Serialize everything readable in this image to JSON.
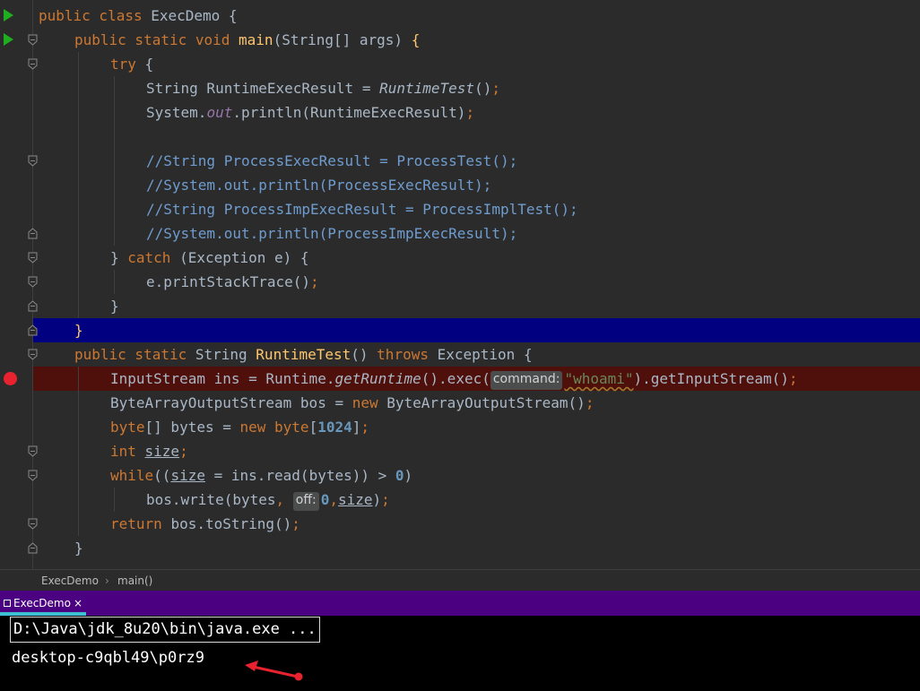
{
  "editor": {
    "lines": [
      [
        [
          "kw",
          "public class "
        ],
        [
          "plain",
          "ExecDemo {"
        ]
      ],
      [
        [
          "kw",
          "public static void "
        ],
        [
          "fn",
          "main"
        ],
        [
          "plain",
          "(String[] args) "
        ],
        [
          "fn",
          "{"
        ]
      ],
      [
        [
          "kw",
          "try "
        ],
        [
          "plain",
          "{"
        ]
      ],
      [
        [
          "plain",
          "String RuntimeExecResult = "
        ],
        [
          "it",
          "RuntimeTest"
        ],
        [
          "plain",
          "()"
        ],
        [
          "kw",
          ";"
        ]
      ],
      [
        [
          "plain",
          "System."
        ],
        [
          "field",
          "out"
        ],
        [
          "plain",
          ".println(RuntimeExecResult)"
        ],
        [
          "kw",
          ";"
        ]
      ],
      [],
      [
        [
          "cm",
          "//String ProcessExecResult = ProcessTest();"
        ]
      ],
      [
        [
          "cm",
          "//System.out.println(ProcessExecResult);"
        ]
      ],
      [
        [
          "cm",
          "//String ProcessImpExecResult = ProcessImplTest();"
        ]
      ],
      [
        [
          "cm",
          "//System.out.println(ProcessImpExecResult);"
        ]
      ],
      [
        [
          "plain",
          "} "
        ],
        [
          "kw",
          "catch "
        ],
        [
          "plain",
          "(Exception e) {"
        ]
      ],
      [
        [
          "plain",
          "e.printStackTrace()"
        ],
        [
          "kw",
          ";"
        ]
      ],
      [
        [
          "plain",
          "}"
        ]
      ],
      [
        [
          "fn",
          "}"
        ]
      ],
      [
        [
          "kw",
          "public static "
        ],
        [
          "plain",
          "String "
        ],
        [
          "fn",
          "RuntimeTest"
        ],
        [
          "plain",
          "() "
        ],
        [
          "kw",
          "throws "
        ],
        [
          "plain",
          "Exception {"
        ]
      ],
      [
        [
          "plain",
          "InputStream ins = Runtime."
        ],
        [
          "it",
          "getRuntime"
        ],
        [
          "plain",
          "().exec("
        ],
        [
          "hint",
          "command:"
        ],
        [
          "strw",
          "\"whoami\""
        ],
        [
          "plain",
          ").getInputStream()"
        ],
        [
          "kw",
          ";"
        ]
      ],
      [
        [
          "plain",
          "ByteArrayOutputStream bos = "
        ],
        [
          "kw",
          "new "
        ],
        [
          "plain",
          "ByteArrayOutputStream()"
        ],
        [
          "kw",
          ";"
        ]
      ],
      [
        [
          "kw",
          "byte"
        ],
        [
          "plain",
          "[] bytes = "
        ],
        [
          "kw",
          "new byte"
        ],
        [
          "plain",
          "["
        ],
        [
          "num",
          "1024"
        ],
        [
          "plain",
          "]"
        ],
        [
          "kw",
          ";"
        ]
      ],
      [
        [
          "kw",
          "int "
        ],
        [
          "u",
          "size"
        ],
        [
          "kw",
          ";"
        ]
      ],
      [
        [
          "kw",
          "while"
        ],
        [
          "plain",
          "(("
        ],
        [
          "u",
          "size"
        ],
        [
          "plain",
          " = ins.read(bytes)) > "
        ],
        [
          "num",
          "0"
        ],
        [
          "plain",
          ")"
        ]
      ],
      [
        [
          "plain",
          "bos.write(bytes"
        ],
        [
          "kw",
          ", "
        ],
        [
          "hint",
          "off:"
        ],
        [
          "num",
          "0"
        ],
        [
          "kw",
          ","
        ],
        [
          "u",
          "size"
        ],
        [
          "plain",
          ")"
        ],
        [
          "kw",
          ";"
        ]
      ],
      [
        [
          "kw",
          "return "
        ],
        [
          "plain",
          "bos.toString()"
        ],
        [
          "kw",
          ";"
        ]
      ],
      [
        [
          "plain",
          "}"
        ]
      ]
    ]
  },
  "breadcrumb": {
    "class_name": "ExecDemo",
    "separator": "›",
    "method_name": "main()"
  },
  "run_window": {
    "tab_label": "ExecDemo",
    "tab_close": "×",
    "command_line": "D:\\Java\\jdk_8u20\\bin\\java.exe ...",
    "output_line": "desktop-c9qbl49\\p0rz9"
  },
  "colors": {
    "editor_bg": "#2b2b2b",
    "current_line": "#000080",
    "breakpoint_line": "#4f0f0a",
    "run_tab_bar": "#4b0082",
    "tab_underline": "#3dbfd4",
    "annotation_arrow": "#e8222e"
  },
  "icons": {
    "run": "run-gutter-icon",
    "breakpoint": "breakpoint-icon",
    "fold": "fold-marker-icon",
    "arrow": "red-annotation-arrow"
  }
}
